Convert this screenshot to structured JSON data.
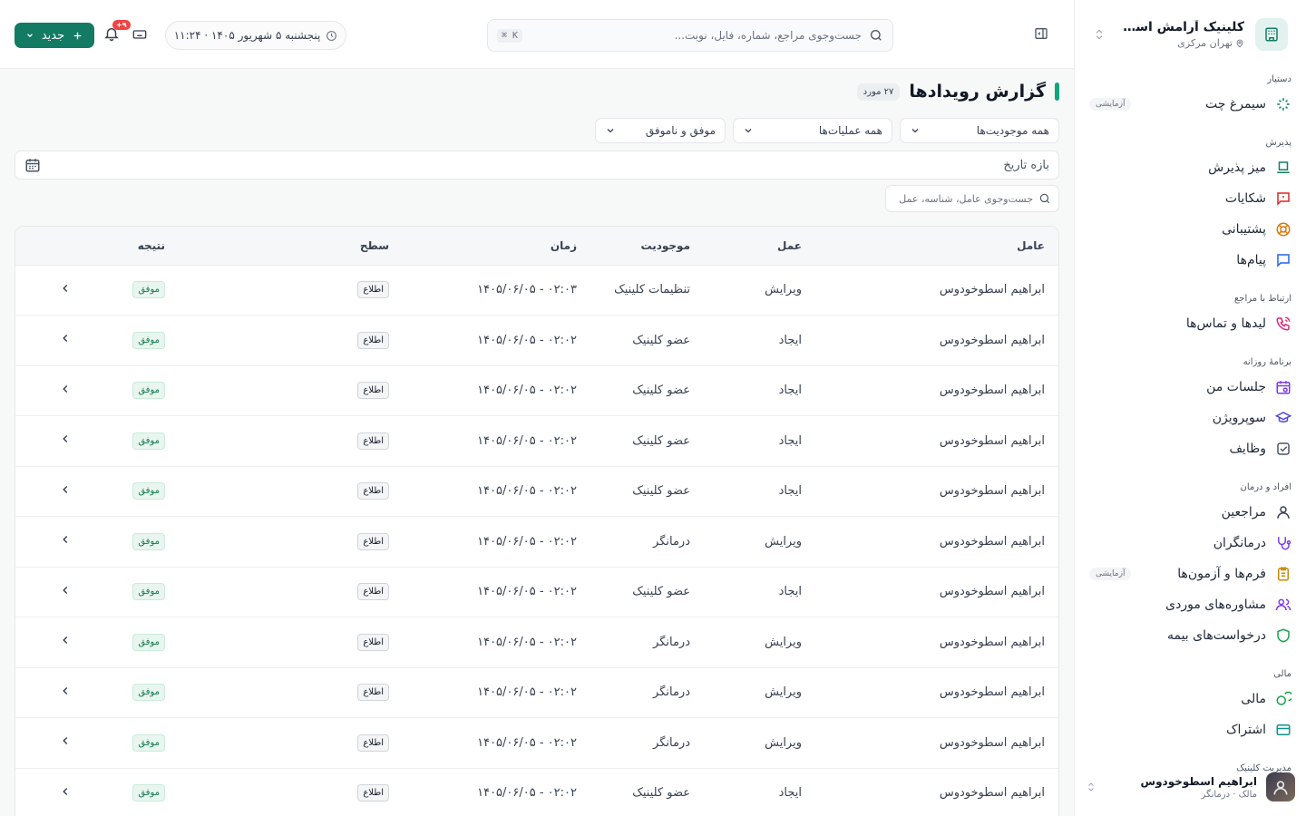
{
  "sidebar": {
    "clinic_name": "کلینیک آرامش اسطوخو...",
    "clinic_city": "تهران مرکزی",
    "sections": [
      {
        "title": "دستیار",
        "items": [
          {
            "label": "سیمرغ چت",
            "icon": "sparkles-icon",
            "badge": "آزمایشی"
          }
        ]
      },
      {
        "title": "پذیرش",
        "items": [
          {
            "label": "میز پذیرش",
            "icon": "reception-desk-icon",
            "badge": ""
          },
          {
            "label": "شکایات",
            "icon": "alert-message-icon",
            "badge": ""
          },
          {
            "label": "پشتیبانی",
            "icon": "lifebuoy-icon",
            "badge": ""
          },
          {
            "label": "پیام‌ها",
            "icon": "chat-icon",
            "badge": ""
          }
        ]
      },
      {
        "title": "ارتباط با مراجع",
        "items": [
          {
            "label": "لیدها و تماس‌ها",
            "icon": "phone-call-icon",
            "badge": ""
          }
        ]
      },
      {
        "title": "برنامهٔ روزانه",
        "items": [
          {
            "label": "جلسات من",
            "icon": "calendar-clock-icon",
            "badge": ""
          },
          {
            "label": "سوپرویژن",
            "icon": "graduation-cap-icon",
            "badge": ""
          },
          {
            "label": "وظایف",
            "icon": "checkbox-icon",
            "badge": ""
          }
        ]
      },
      {
        "title": "افراد و درمان",
        "items": [
          {
            "label": "مراجعین",
            "icon": "user-icon",
            "badge": ""
          },
          {
            "label": "درمانگران",
            "icon": "stethoscope-icon",
            "badge": ""
          },
          {
            "label": "فرم‌ها و آزمون‌ها",
            "icon": "clipboard-icon",
            "badge": "آزمایشی"
          },
          {
            "label": "مشاوره‌های موردی",
            "icon": "users-icon",
            "badge": ""
          },
          {
            "label": "درخواست‌های بیمه",
            "icon": "shield-icon",
            "badge": ""
          }
        ]
      },
      {
        "title": "مالی",
        "items": [
          {
            "label": "مالی",
            "icon": "coins-icon",
            "badge": ""
          },
          {
            "label": "اشتراک",
            "icon": "credit-card-icon",
            "badge": ""
          }
        ]
      },
      {
        "title": "مدیریت کلینیک",
        "items": []
      }
    ],
    "user": {
      "name": "ابراهیم اسطوخودوس",
      "role": "مالک · درمانگر"
    }
  },
  "header": {
    "search_placeholder": "جست‌وجوی مراجع، شماره، فایل، نوبت...",
    "search_shortcut": "⌘ K",
    "datetime": "پنجشنبه ۵ شهریور ۱۴۰۵ · ۱۱:۲۴",
    "notification_count": "۹+",
    "new_button": "جدید"
  },
  "main": {
    "title": "گزارش رویدادها",
    "count": "۲۷ مورد",
    "filters": {
      "entity": "همه موجودیت‌ها",
      "operation": "همه عملیات‌ها",
      "status": "موفق و ناموفق"
    },
    "date_range_placeholder": "بازه تاریخ",
    "table_search_placeholder": "جست‌وجوی عامل، شناسه، عمل"
  },
  "table": {
    "columns": [
      "عامل",
      "عمل",
      "موجودیت",
      "زمان",
      "سطح",
      "نتیجه"
    ],
    "rows": [
      {
        "actor": "ابراهیم اسطوخودوس",
        "action": "ویرایش",
        "entity": "تنظیمات کلینیک",
        "time": "۱۴۰۵/۰۶/۰۵ - ۰۲:۰۳",
        "level": "اطلاع",
        "result": "موفق"
      },
      {
        "actor": "ابراهیم اسطوخودوس",
        "action": "ایجاد",
        "entity": "عضو کلینیک",
        "time": "۱۴۰۵/۰۶/۰۵ - ۰۲:۰۲",
        "level": "اطلاع",
        "result": "موفق"
      },
      {
        "actor": "ابراهیم اسطوخودوس",
        "action": "ایجاد",
        "entity": "عضو کلینیک",
        "time": "۱۴۰۵/۰۶/۰۵ - ۰۲:۰۲",
        "level": "اطلاع",
        "result": "موفق"
      },
      {
        "actor": "ابراهیم اسطوخودوس",
        "action": "ایجاد",
        "entity": "عضو کلینیک",
        "time": "۱۴۰۵/۰۶/۰۵ - ۰۲:۰۲",
        "level": "اطلاع",
        "result": "موفق"
      },
      {
        "actor": "ابراهیم اسطوخودوس",
        "action": "ایجاد",
        "entity": "عضو کلینیک",
        "time": "۱۴۰۵/۰۶/۰۵ - ۰۲:۰۲",
        "level": "اطلاع",
        "result": "موفق"
      },
      {
        "actor": "ابراهیم اسطوخودوس",
        "action": "ویرایش",
        "entity": "درمانگر",
        "time": "۱۴۰۵/۰۶/۰۵ - ۰۲:۰۲",
        "level": "اطلاع",
        "result": "موفق"
      },
      {
        "actor": "ابراهیم اسطوخودوس",
        "action": "ایجاد",
        "entity": "عضو کلینیک",
        "time": "۱۴۰۵/۰۶/۰۵ - ۰۲:۰۲",
        "level": "اطلاع",
        "result": "موفق"
      },
      {
        "actor": "ابراهیم اسطوخودوس",
        "action": "ویرایش",
        "entity": "درمانگر",
        "time": "۱۴۰۵/۰۶/۰۵ - ۰۲:۰۲",
        "level": "اطلاع",
        "result": "موفق"
      },
      {
        "actor": "ابراهیم اسطوخودوس",
        "action": "ویرایش",
        "entity": "درمانگر",
        "time": "۱۴۰۵/۰۶/۰۵ - ۰۲:۰۲",
        "level": "اطلاع",
        "result": "موفق"
      },
      {
        "actor": "ابراهیم اسطوخودوس",
        "action": "ویرایش",
        "entity": "درمانگر",
        "time": "۱۴۰۵/۰۶/۰۵ - ۰۲:۰۲",
        "level": "اطلاع",
        "result": "موفق"
      },
      {
        "actor": "ابراهیم اسطوخودوس",
        "action": "ایجاد",
        "entity": "عضو کلینیک",
        "time": "۱۴۰۵/۰۶/۰۵ - ۰۲:۰۲",
        "level": "اطلاع",
        "result": "موفق"
      }
    ]
  },
  "colors": {
    "accent": "#137a63",
    "accent_bright": "#14a37f",
    "success_bg": "#e8f6ef",
    "badge_red": "#ef4444"
  }
}
